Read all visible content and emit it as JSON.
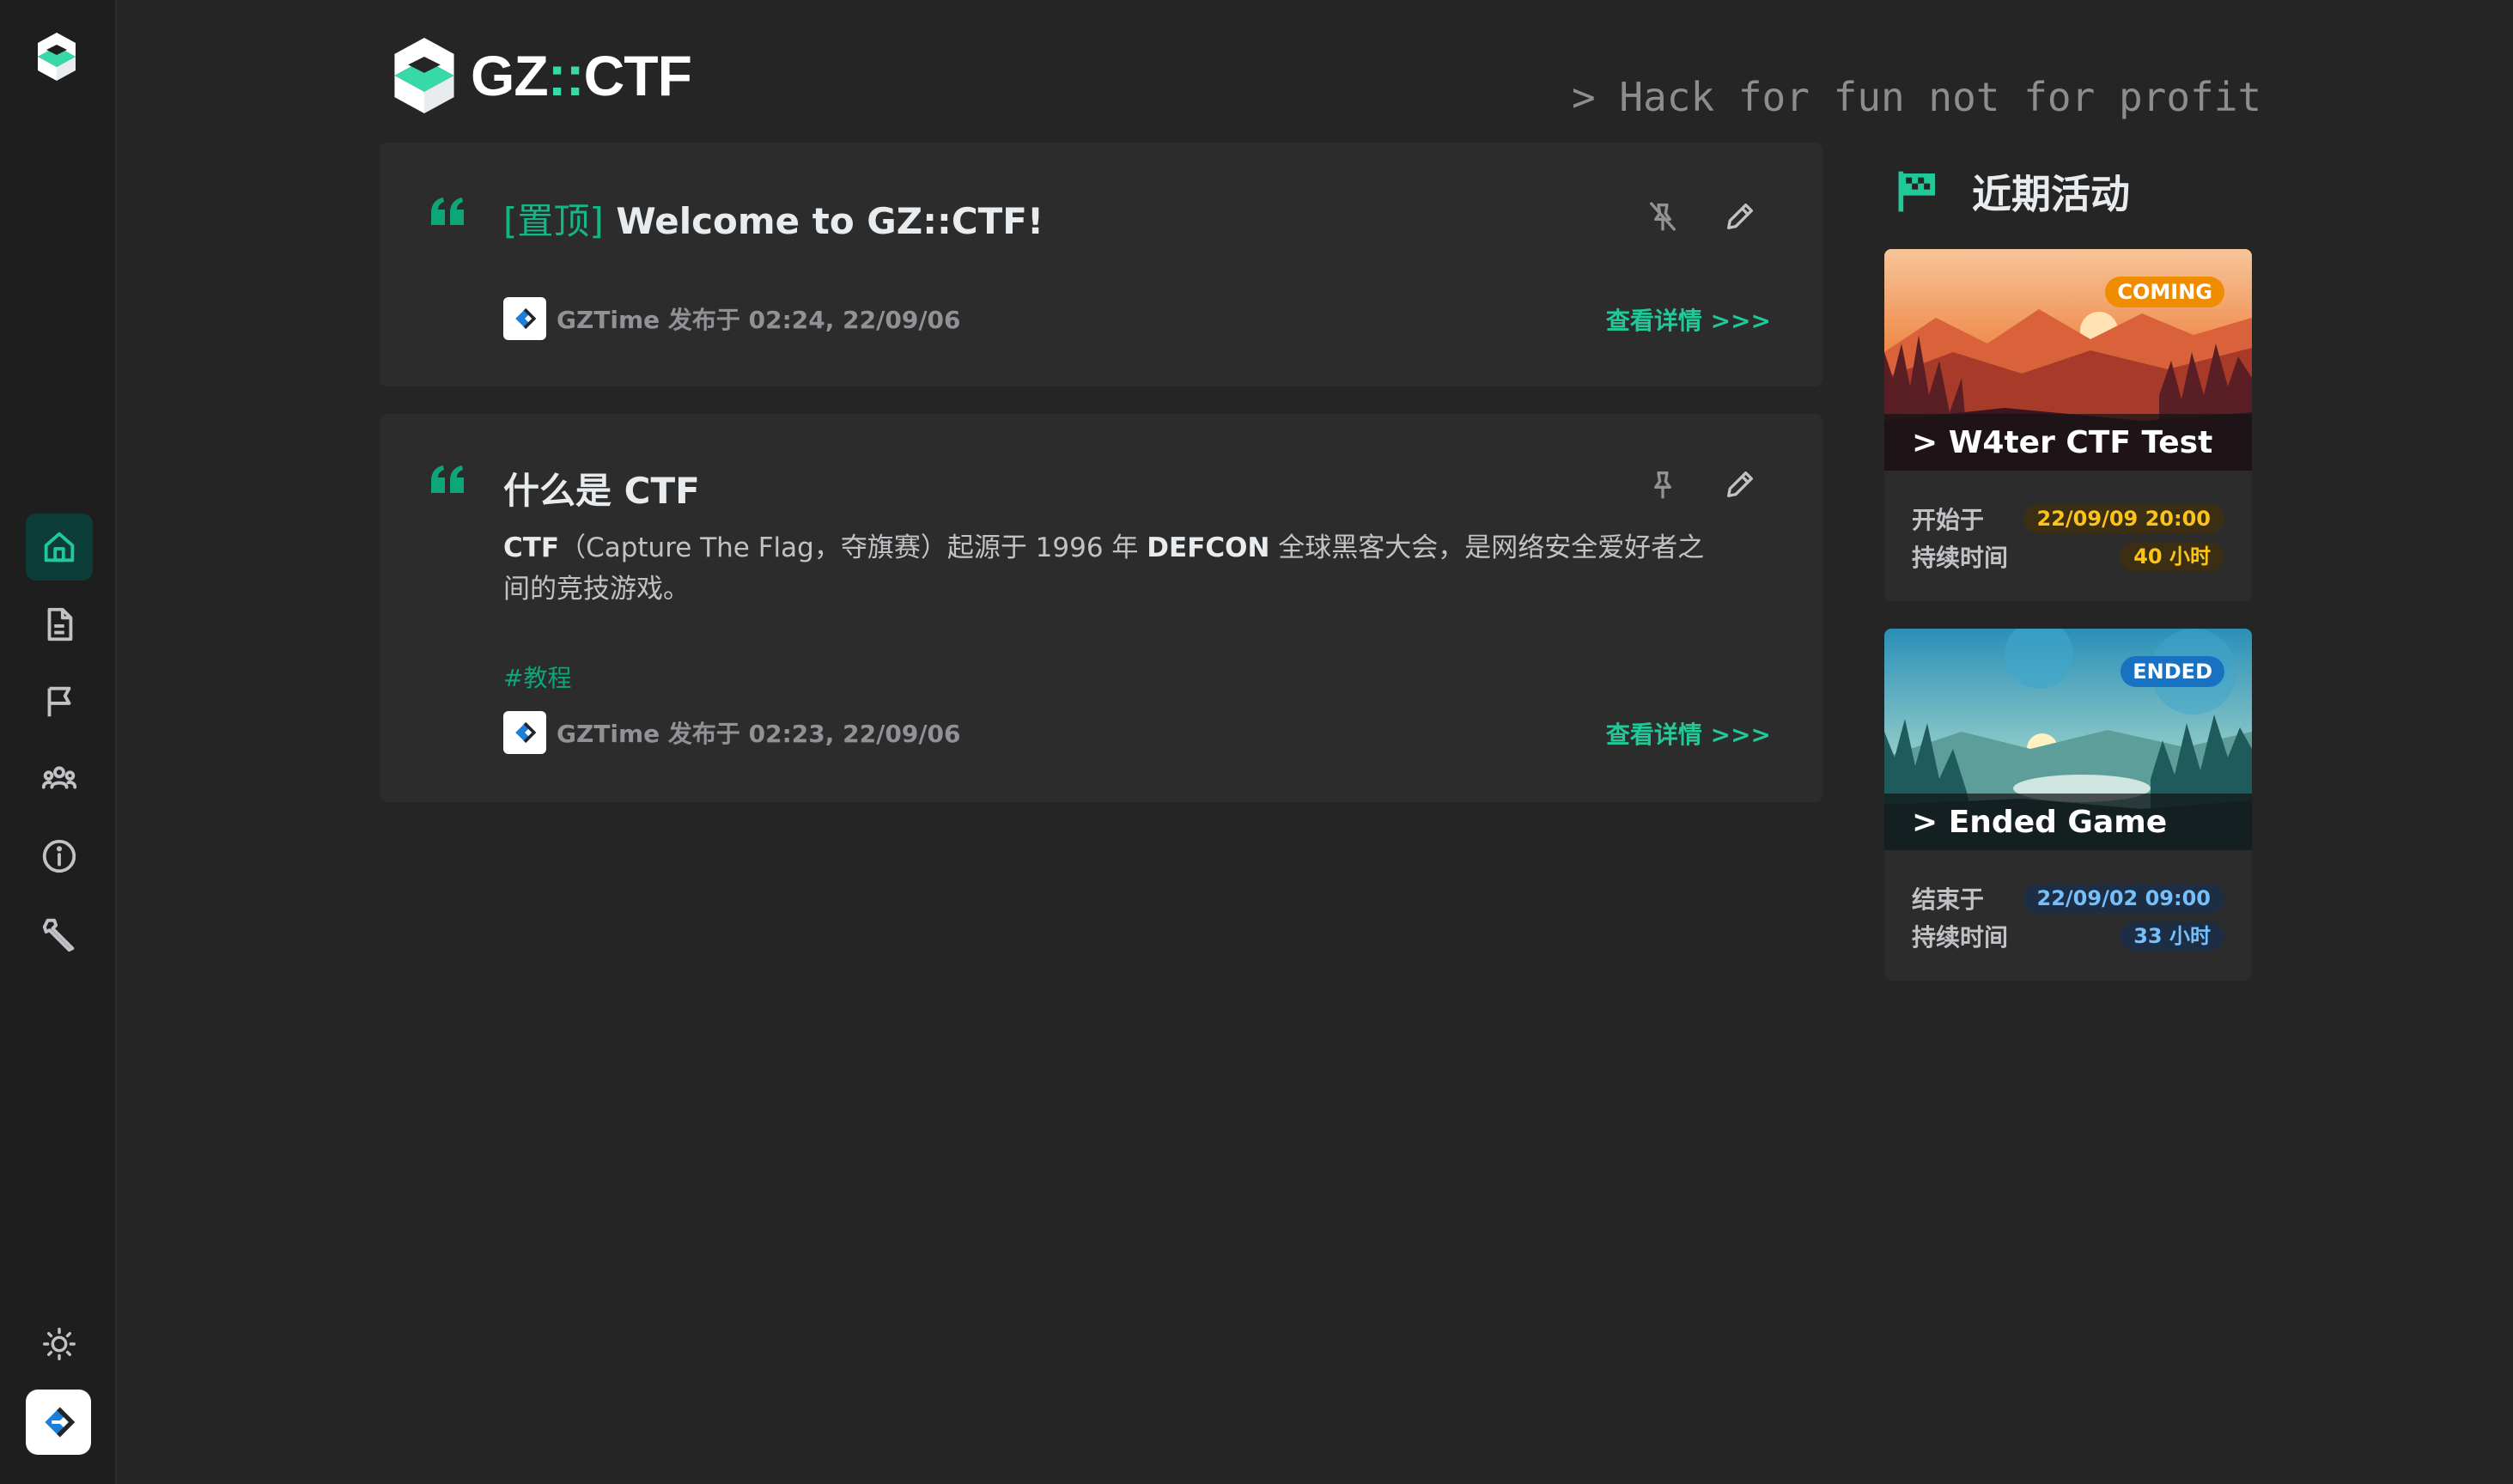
{
  "sidebar": {
    "items": [
      {
        "icon": "home-icon",
        "active": true
      },
      {
        "icon": "document-icon"
      },
      {
        "icon": "flag-icon"
      },
      {
        "icon": "team-icon"
      },
      {
        "icon": "info-icon"
      },
      {
        "icon": "wrench-icon"
      }
    ],
    "bottom": {
      "theme_icon": "sun-icon",
      "avatar": "user-avatar"
    }
  },
  "header": {
    "brand_prefix": "GZ",
    "brand_sep": "::",
    "brand_suffix": "CTF",
    "slogan": "> Hack for fun not for profit"
  },
  "posts": [
    {
      "pin_label": "[置顶]",
      "title": "Welcome to GZ::CTF!",
      "author": "GZTime",
      "meta": "GZTime 发布于 02:24, 22/09/06",
      "details": "查看详情 >>>",
      "pinned": true
    },
    {
      "title": "什么是 CTF",
      "body_parts": {
        "b1": "CTF",
        "t1": "（Capture The Flag，夺旗赛）起源于 1996 年 ",
        "b2": "DEFCON",
        "t2": " 全球黑客大会，是网络安全爱好者之间的竞技游戏。"
      },
      "tag": "#教程",
      "meta": "GZTime 发布于 02:23, 22/09/06",
      "details": "查看详情 >>>",
      "pinned": false
    }
  ],
  "recent_events": {
    "title": "近期活动",
    "games": [
      {
        "badge": "COMING",
        "badge_color": "#f08c00",
        "name": "> W4ter CTF Test",
        "row1_label": "开始于",
        "row1_value": "22/09/09 20:00",
        "row2_label": "持续时间",
        "row2_value": "40 小时"
      },
      {
        "badge": "ENDED",
        "badge_color": "#1971c2",
        "name": "> Ended Game",
        "row1_label": "结束于",
        "row1_value": "22/09/02 09:00",
        "row2_label": "持续时间",
        "row2_value": "33 小时"
      }
    ]
  },
  "colors": {
    "accent": "#20c997",
    "background": "#252525",
    "card": "#2c2c2c"
  }
}
